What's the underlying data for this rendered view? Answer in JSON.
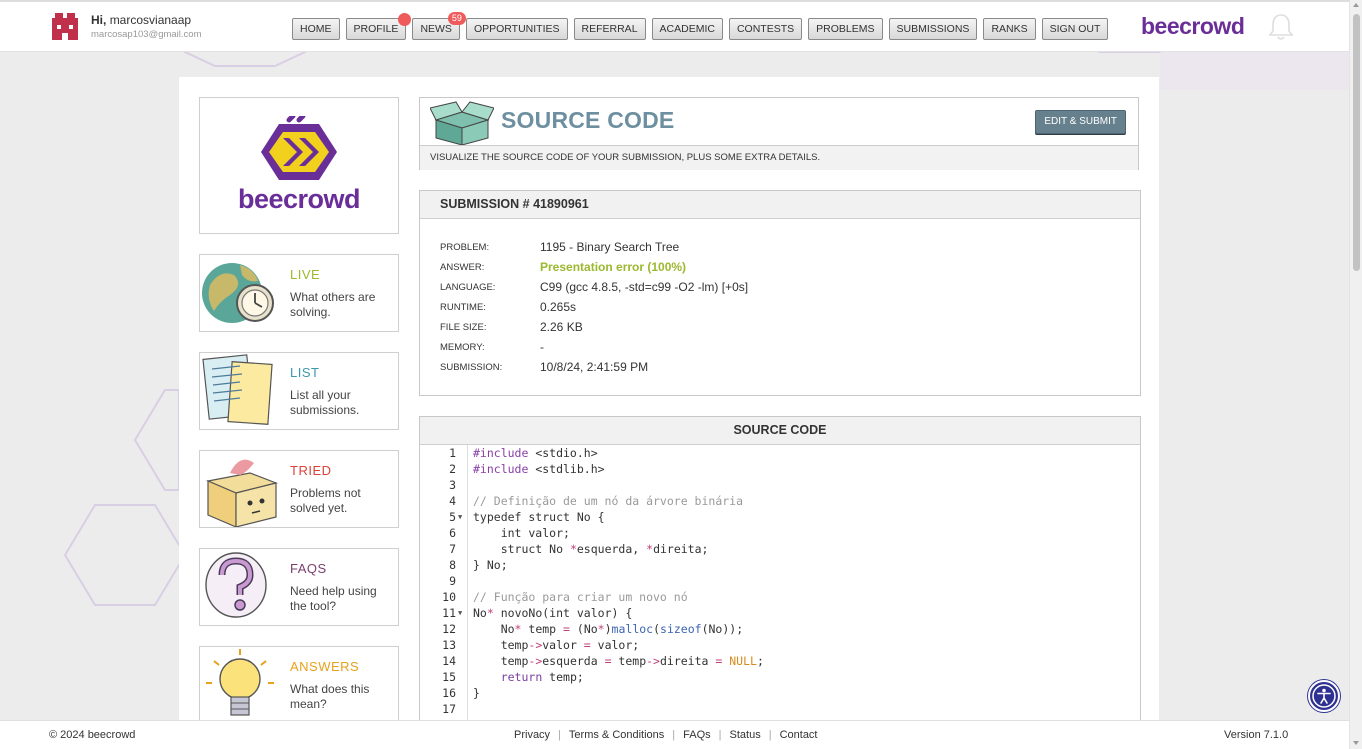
{
  "user": {
    "greeting": "Hi,",
    "name": "marcosvianaap",
    "email": "marcosap103@gmail.com"
  },
  "nav": [
    {
      "label": "HOME",
      "badge": ""
    },
    {
      "label": "PROFILE",
      "badge": "dot"
    },
    {
      "label": "NEWS",
      "badge": "59"
    },
    {
      "label": "OPPORTUNITIES",
      "badge": ""
    },
    {
      "label": "REFERRAL",
      "badge": ""
    },
    {
      "label": "ACADEMIC",
      "badge": ""
    },
    {
      "label": "CONTESTS",
      "badge": ""
    },
    {
      "label": "PROBLEMS",
      "badge": ""
    },
    {
      "label": "SUBMISSIONS",
      "badge": ""
    },
    {
      "label": "RANKS",
      "badge": ""
    },
    {
      "label": "SIGN OUT",
      "badge": ""
    }
  ],
  "brand": "beecrowd",
  "sidebar": {
    "logo_text": "beecrowd",
    "cards": [
      {
        "title": "LIVE",
        "desc": "What others are solving.",
        "color": "#9ab92e",
        "icon": "globe-clock-icon"
      },
      {
        "title": "LIST",
        "desc": "List all your submissions.",
        "color": "#3a9aa8",
        "icon": "papers-icon"
      },
      {
        "title": "TRIED",
        "desc": "Problems not solved yet.",
        "color": "#d9433a",
        "icon": "box-icon"
      },
      {
        "title": "FAQS",
        "desc": "Need help using the tool?",
        "color": "#7a3f6e",
        "icon": "question-icon"
      },
      {
        "title": "ANSWERS",
        "desc": "What does this mean?",
        "color": "#e8a21a",
        "icon": "lightbulb-icon"
      }
    ]
  },
  "header": {
    "title": "SOURCE CODE",
    "edit_button": "EDIT & SUBMIT",
    "subtitle": "VISUALIZE THE SOURCE CODE OF YOUR SUBMISSION, PLUS SOME EXTRA DETAILS."
  },
  "submission": {
    "title": "SUBMISSION # 41890961",
    "rows": [
      {
        "key": "PROBLEM:",
        "value": "1195 - Binary Search Tree"
      },
      {
        "key": "ANSWER:",
        "value": "Presentation error (100%)"
      },
      {
        "key": "LANGUAGE:",
        "value": "C99 (gcc 4.8.5, -std=c99 -O2 -lm) [+0s]"
      },
      {
        "key": "RUNTIME:",
        "value": "0.265s"
      },
      {
        "key": "FILE SIZE:",
        "value": "2.26 KB"
      },
      {
        "key": "MEMORY:",
        "value": "-"
      },
      {
        "key": "SUBMISSION:",
        "value": "10/8/24, 2:41:59 PM"
      }
    ]
  },
  "code": {
    "title": "SOURCE CODE",
    "lines": [
      "#include <stdio.h>",
      "#include <stdlib.h>",
      "",
      "// Definição de um nó da árvore binária",
      "typedef struct No {",
      "    int valor;",
      "    struct No *esquerda, *direita;",
      "} No;",
      "",
      "// Função para criar um novo nó",
      "No* novoNo(int valor) {",
      "    No* temp = (No*)malloc(sizeof(No));",
      "    temp->valor = valor;",
      "    temp->esquerda = temp->direita = NULL;",
      "    return temp;",
      "}",
      ""
    ],
    "fold_lines": [
      5,
      11
    ]
  },
  "footer": {
    "copyright": "© 2024 beecrowd",
    "links": [
      "Privacy",
      "Terms & Conditions",
      "FAQs",
      "Status",
      "Contact"
    ],
    "version": "Version 7.1.0"
  }
}
